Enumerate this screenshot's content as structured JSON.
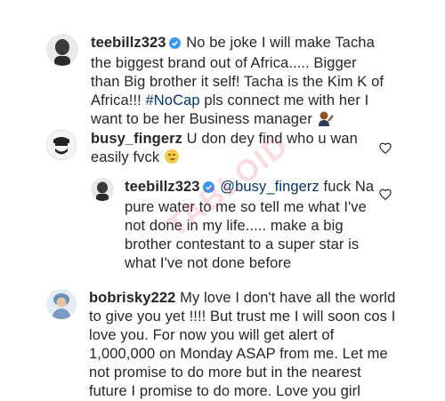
{
  "comments": [
    {
      "username": "teebillz323",
      "verified": true,
      "text_before_tag": "No be joke I will make Tacha the biggest brand out of Africa..... Bigger than Big brother it self! Tacha is the Kim K of Africa!!! ",
      "hashtag": "#NoCap",
      "text_after_tag": " pls connect me with her I want to be her Business manager"
    },
    {
      "username": "busy_fingerz",
      "verified": false,
      "text": "U don dey find who u wan easily fvck"
    },
    {
      "username": "teebillz323",
      "verified": true,
      "mention": "@busy_fingerz",
      "text": " fuck Na pure water to me so tell me what I've not done in my life..... make a big brother contestant to a super star is what I've not done before"
    },
    {
      "username": "bobrisky222",
      "verified": false,
      "text": "My love I don't have all the world to give you yet !!!! But trust me I will soon cos I love you. For now you will get alert of 1,000,000 on Monday ASAP from me. Let me not promise to do more but in the nearest future I promise to do more. Love you girl"
    }
  ],
  "watermark": "TABLOID",
  "icons": [
    "verified-badge-icon",
    "heart-icon",
    "person-gesturing-emoji",
    "smirk-emoji"
  ],
  "colors": {
    "username": "#262626",
    "hashtag": "#003569",
    "verified": "#3897f0",
    "heart": "#262626"
  }
}
